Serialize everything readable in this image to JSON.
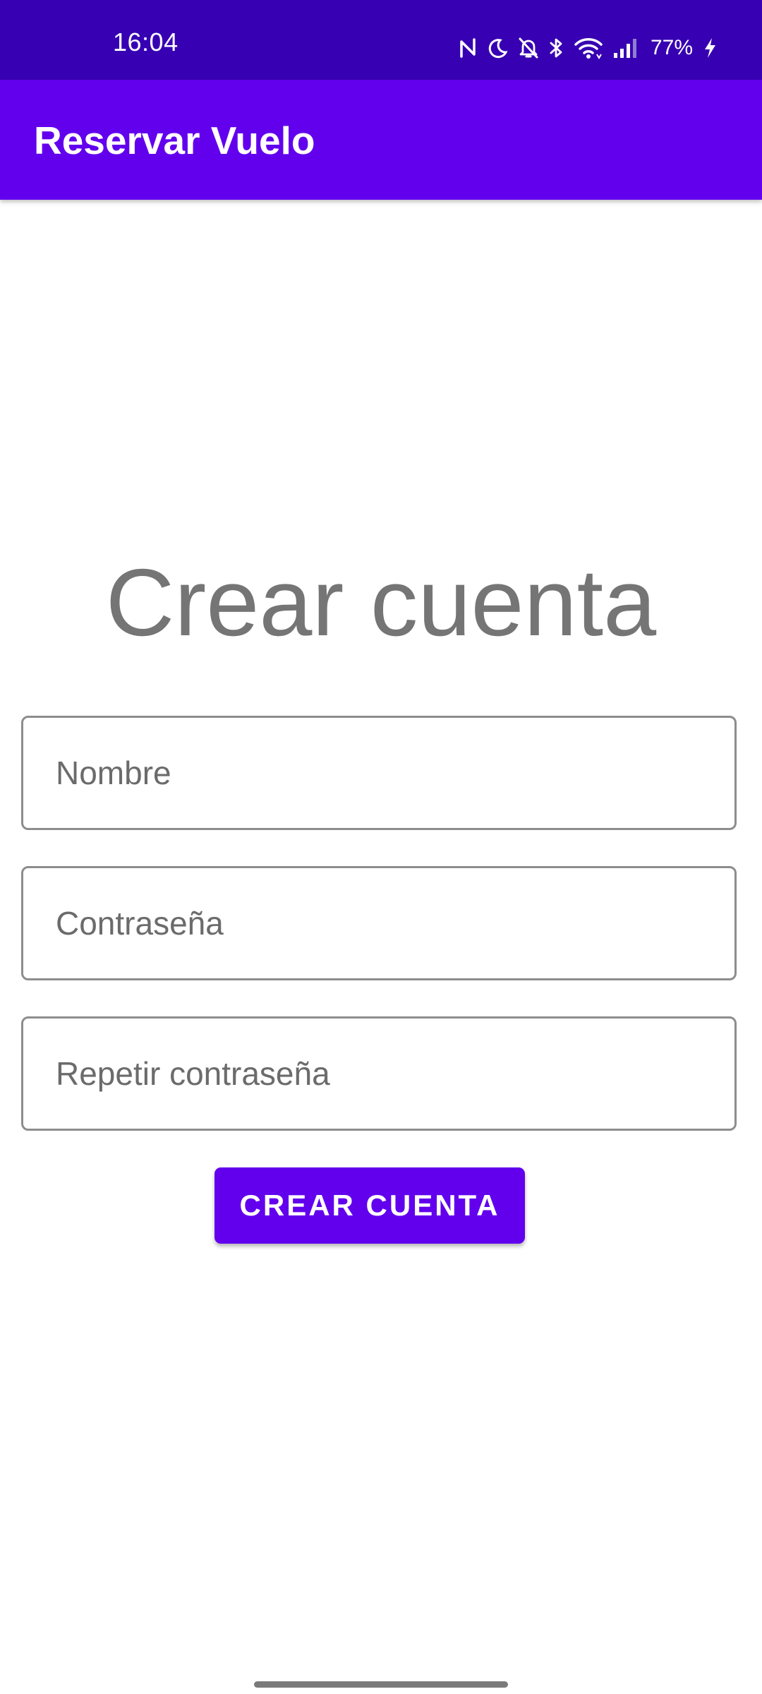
{
  "status_bar": {
    "time": "16:04",
    "battery": "77%",
    "icons": [
      "nfc-icon",
      "do-not-disturb-moon-icon",
      "notifications-off-icon",
      "bluetooth-icon",
      "wifi-icon",
      "cellular-signal-icon",
      "battery-charging-icon"
    ]
  },
  "app_bar": {
    "title": "Reservar Vuelo"
  },
  "main": {
    "heading": "Crear cuenta",
    "fields": {
      "name_placeholder": "Nombre",
      "password_placeholder": "Contraseña",
      "repeat_password_placeholder": "Repetir contraseña"
    },
    "button_label": "CREAR CUENTA"
  },
  "colors": {
    "status_bar": "#3700B3",
    "primary": "#6200EE",
    "heading_text": "#757575"
  }
}
